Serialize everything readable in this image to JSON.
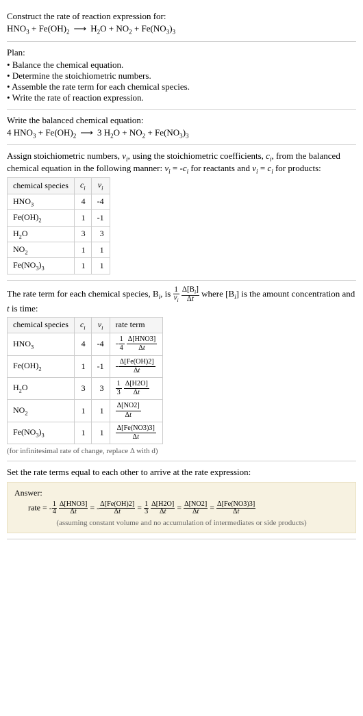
{
  "header": {
    "prompt": "Construct the rate of reaction expression for:",
    "reactants": [
      "HNO_3",
      "Fe(OH)_2"
    ],
    "products": [
      "H_2O",
      "NO_2",
      "Fe(NO_3)_3"
    ]
  },
  "plan": {
    "label": "Plan:",
    "items": [
      "Balance the chemical equation.",
      "Determine the stoichiometric numbers.",
      "Assemble the rate term for each chemical species.",
      "Write the rate of reaction expression."
    ]
  },
  "balanced": {
    "label": "Write the balanced chemical equation:",
    "left": [
      {
        "coef": "4",
        "species": "HNO_3"
      },
      {
        "coef": "",
        "species": "Fe(OH)_2"
      }
    ],
    "right": [
      {
        "coef": "3",
        "species": "H_2O"
      },
      {
        "coef": "",
        "species": "NO_2"
      },
      {
        "coef": "",
        "species": "Fe(NO_3)_3"
      }
    ]
  },
  "stoich_intro": "Assign stoichiometric numbers, ν_i, using the stoichiometric coefficients, c_i, from the balanced chemical equation in the following manner: ν_i = -c_i for reactants and ν_i = c_i for products:",
  "stoich_table": {
    "headers": [
      "chemical species",
      "c_i",
      "ν_i"
    ],
    "rows": [
      {
        "species": "HNO_3",
        "c": "4",
        "nu": "-4"
      },
      {
        "species": "Fe(OH)_2",
        "c": "1",
        "nu": "-1"
      },
      {
        "species": "H_2O",
        "c": "3",
        "nu": "3"
      },
      {
        "species": "NO_2",
        "c": "1",
        "nu": "1"
      },
      {
        "species": "Fe(NO_3)_3",
        "c": "1",
        "nu": "1"
      }
    ]
  },
  "rate_intro": {
    "prefix": "The rate term for each chemical species, B_i, is ",
    "mid": " where [B_i] is the amount concentration and ",
    "suffix": " is time:",
    "t_var": "t"
  },
  "rate_table": {
    "headers": [
      "chemical species",
      "c_i",
      "ν_i",
      "rate term"
    ],
    "rows": [
      {
        "species": "HNO_3",
        "c": "4",
        "nu": "-4",
        "rt_prefix": "-",
        "rt_coef_n": "1",
        "rt_coef_d": "4",
        "rt_bracket": "[HNO3]"
      },
      {
        "species": "Fe(OH)_2",
        "c": "1",
        "nu": "-1",
        "rt_prefix": "-",
        "rt_coef_n": "",
        "rt_coef_d": "",
        "rt_bracket": "[Fe(OH)2]"
      },
      {
        "species": "H_2O",
        "c": "3",
        "nu": "3",
        "rt_prefix": "",
        "rt_coef_n": "1",
        "rt_coef_d": "3",
        "rt_bracket": "[H2O]"
      },
      {
        "species": "NO_2",
        "c": "1",
        "nu": "1",
        "rt_prefix": "",
        "rt_coef_n": "",
        "rt_coef_d": "",
        "rt_bracket": "[NO2]"
      },
      {
        "species": "Fe(NO_3)_3",
        "c": "1",
        "nu": "1",
        "rt_prefix": "",
        "rt_coef_n": "",
        "rt_coef_d": "",
        "rt_bracket": "[Fe(NO3)3]"
      }
    ]
  },
  "rate_note": "(for infinitesimal rate of change, replace Δ with d)",
  "final_intro": "Set the rate terms equal to each other to arrive at the rate expression:",
  "answer": {
    "label": "Answer:",
    "rate_label": "rate",
    "terms": [
      {
        "prefix": "-",
        "coef_n": "1",
        "coef_d": "4",
        "bracket": "[HNO3]"
      },
      {
        "prefix": "-",
        "coef_n": "",
        "coef_d": "",
        "bracket": "[Fe(OH)2]"
      },
      {
        "prefix": "",
        "coef_n": "1",
        "coef_d": "3",
        "bracket": "[H2O]"
      },
      {
        "prefix": "",
        "coef_n": "",
        "coef_d": "",
        "bracket": "[NO2]"
      },
      {
        "prefix": "",
        "coef_n": "",
        "coef_d": "",
        "bracket": "[Fe(NO3)3]"
      }
    ],
    "note": "(assuming constant volume and no accumulation of intermediates or side products)"
  },
  "chart_data": {
    "type": "table",
    "title": "Stoichiometric coefficients and rate terms",
    "rows": [
      {
        "species": "HNO3",
        "c_i": 4,
        "nu_i": -4,
        "rate_term": "-(1/4) Δ[HNO3]/Δt"
      },
      {
        "species": "Fe(OH)2",
        "c_i": 1,
        "nu_i": -1,
        "rate_term": "-Δ[Fe(OH)2]/Δt"
      },
      {
        "species": "H2O",
        "c_i": 3,
        "nu_i": 3,
        "rate_term": "(1/3) Δ[H2O]/Δt"
      },
      {
        "species": "NO2",
        "c_i": 1,
        "nu_i": 1,
        "rate_term": "Δ[NO2]/Δt"
      },
      {
        "species": "Fe(NO3)3",
        "c_i": 1,
        "nu_i": 1,
        "rate_term": "Δ[Fe(NO3)3]/Δt"
      }
    ],
    "balanced_equation": "4 HNO3 + Fe(OH)2 → 3 H2O + NO2 + Fe(NO3)3",
    "rate_expression": "rate = -(1/4) Δ[HNO3]/Δt = -Δ[Fe(OH)2]/Δt = (1/3) Δ[H2O]/Δt = Δ[NO2]/Δt = Δ[Fe(NO3)3]/Δt"
  }
}
